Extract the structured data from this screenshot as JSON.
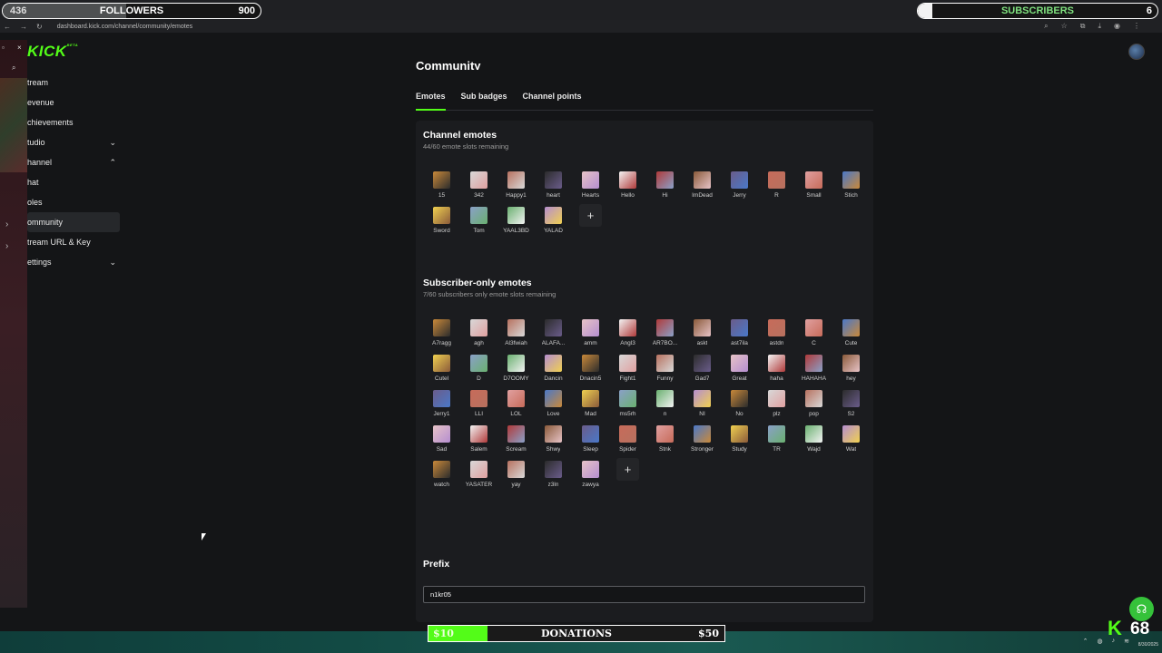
{
  "overlay": {
    "followers": {
      "current": "436",
      "title": "FOLLOWERS",
      "goal": "900",
      "progress_pct": 48
    },
    "subscribers": {
      "title": "SUBSCRIBERS",
      "goal": "6",
      "progress_pct": 6
    },
    "donations": {
      "current": "$10",
      "title": "DONATIONS",
      "goal": "$50",
      "progress_pct": 20
    },
    "viewer_count": "68"
  },
  "browser": {
    "url": "dashboard.kick.com/channel/community/emotes",
    "date": "8/30/2025"
  },
  "brand": {
    "logo": "KICK",
    "logo_tag": "BETA",
    "accent": "#53fc18"
  },
  "sidebar": {
    "items": [
      {
        "label": "tream",
        "chevron": ""
      },
      {
        "label": "evenue",
        "chevron": ""
      },
      {
        "label": "chievements",
        "chevron": ""
      },
      {
        "label": "tudio",
        "chevron": "⌄"
      },
      {
        "label": "hannel",
        "chevron": "⌃"
      },
      {
        "label": "hat",
        "chevron": ""
      },
      {
        "label": "oles",
        "chevron": ""
      },
      {
        "label": "ommunity",
        "chevron": ""
      },
      {
        "label": "tream URL & Key",
        "chevron": ""
      },
      {
        "label": "ettings",
        "chevron": "⌄"
      }
    ]
  },
  "main": {
    "title": "Community",
    "tabs": [
      "Emotes",
      "Sub badges",
      "Channel points"
    ],
    "channel_emotes": {
      "title": "Channel emotes",
      "subtitle": "44/60 emote slots remaining",
      "emotes": [
        "15",
        "342",
        "Happy1",
        "heart",
        "Hearts",
        "Hello",
        "Hi",
        "ImDead",
        "Jerry",
        "R",
        "Small",
        "Stich",
        "Sword",
        "Tom",
        "YAAL3BD",
        "YALAD"
      ]
    },
    "subscriber_emotes": {
      "title": "Subscriber-only emotes",
      "subtitle": "7/60 subscribers only emote slots remaining",
      "emotes": [
        "A7ragg",
        "agh",
        "Al3fwiah",
        "ALAFA...",
        "amm",
        "Angl3",
        "AR7BO...",
        "askt",
        "ast7ila",
        "astdn",
        "C",
        "Cute",
        "Cutel",
        "D",
        "D7OOMY",
        "Dancin",
        "Dnacin5",
        "Fight1",
        "Funny",
        "Gad7",
        "Great",
        "haha",
        "HAHAHA",
        "hey",
        "Jerry1",
        "LLI",
        "LOL",
        "Love",
        "Mad",
        "ms5rh",
        "n",
        "NI",
        "No",
        "plz",
        "pop",
        "S2",
        "Sad",
        "Salem",
        "Scream",
        "Shwy",
        "Sleep",
        "Spider",
        "Stnk",
        "Stronger",
        "Study",
        "TR",
        "Wajd",
        "Wat",
        "watch",
        "YASATER",
        "yay",
        "z3ln",
        "zawya"
      ]
    },
    "prefix": {
      "title": "Prefix",
      "value": "n1kr05"
    }
  }
}
